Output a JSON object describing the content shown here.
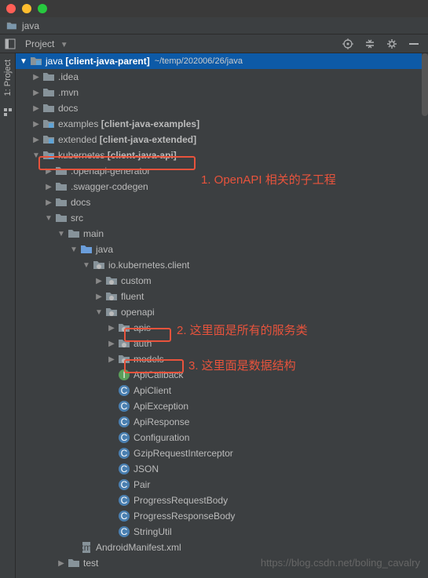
{
  "titlebar": {
    "title": "java"
  },
  "breadcrumb": {
    "root": "java"
  },
  "toolbar": {
    "view_label": "Project"
  },
  "sidebar": {
    "tab1": "1: Project"
  },
  "root": {
    "name": "java",
    "module": "[client-java-parent]",
    "path": "~/temp/202006/26/java"
  },
  "tree": [
    {
      "d": 1,
      "a": "r",
      "i": "folder",
      "t": ".idea"
    },
    {
      "d": 1,
      "a": "r",
      "i": "folder",
      "t": ".mvn"
    },
    {
      "d": 1,
      "a": "r",
      "i": "folder",
      "t": "docs"
    },
    {
      "d": 1,
      "a": "r",
      "i": "module",
      "t": "examples",
      "b": "[client-java-examples]"
    },
    {
      "d": 1,
      "a": "r",
      "i": "module",
      "t": "extended",
      "b": "[client-java-extended]"
    },
    {
      "d": 1,
      "a": "d",
      "i": "module",
      "t": "kubernetes",
      "b": "[client-java-api]"
    },
    {
      "d": 2,
      "a": "r",
      "i": "folder",
      "t": ".openapi-generator"
    },
    {
      "d": 2,
      "a": "r",
      "i": "folder",
      "t": ".swagger-codegen"
    },
    {
      "d": 2,
      "a": "r",
      "i": "folder",
      "t": "docs"
    },
    {
      "d": 2,
      "a": "d",
      "i": "folder",
      "t": "src"
    },
    {
      "d": 3,
      "a": "d",
      "i": "folder",
      "t": "main"
    },
    {
      "d": 4,
      "a": "d",
      "i": "source",
      "t": "java"
    },
    {
      "d": 5,
      "a": "d",
      "i": "package",
      "t": "io.kubernetes.client"
    },
    {
      "d": 6,
      "a": "r",
      "i": "package",
      "t": "custom"
    },
    {
      "d": 6,
      "a": "r",
      "i": "package",
      "t": "fluent"
    },
    {
      "d": 6,
      "a": "d",
      "i": "package",
      "t": "openapi"
    },
    {
      "d": 7,
      "a": "r",
      "i": "package",
      "t": "apis"
    },
    {
      "d": 7,
      "a": "r",
      "i": "package",
      "t": "auth"
    },
    {
      "d": 7,
      "a": "r",
      "i": "package",
      "t": "models"
    },
    {
      "d": 7,
      "a": "",
      "i": "interface",
      "t": "ApiCallback"
    },
    {
      "d": 7,
      "a": "",
      "i": "class",
      "t": "ApiClient"
    },
    {
      "d": 7,
      "a": "",
      "i": "class",
      "t": "ApiException"
    },
    {
      "d": 7,
      "a": "",
      "i": "class",
      "t": "ApiResponse"
    },
    {
      "d": 7,
      "a": "",
      "i": "class",
      "t": "Configuration"
    },
    {
      "d": 7,
      "a": "",
      "i": "class",
      "t": "GzipRequestInterceptor"
    },
    {
      "d": 7,
      "a": "",
      "i": "class",
      "t": "JSON"
    },
    {
      "d": 7,
      "a": "",
      "i": "class",
      "t": "Pair"
    },
    {
      "d": 7,
      "a": "",
      "i": "class",
      "t": "ProgressRequestBody"
    },
    {
      "d": 7,
      "a": "",
      "i": "class",
      "t": "ProgressResponseBody"
    },
    {
      "d": 7,
      "a": "",
      "i": "class",
      "t": "StringUtil"
    },
    {
      "d": 4,
      "a": "",
      "i": "xml",
      "t": "AndroidManifest.xml"
    },
    {
      "d": 3,
      "a": "r",
      "i": "folder",
      "t": "test"
    }
  ],
  "annotations": {
    "a1": "1. OpenAPI 相关的子工程",
    "a2": "2. 这里面是所有的服务类",
    "a3": "3. 这里面是数据结构"
  },
  "watermark": "https://blog.csdn.net/boling_cavalry"
}
